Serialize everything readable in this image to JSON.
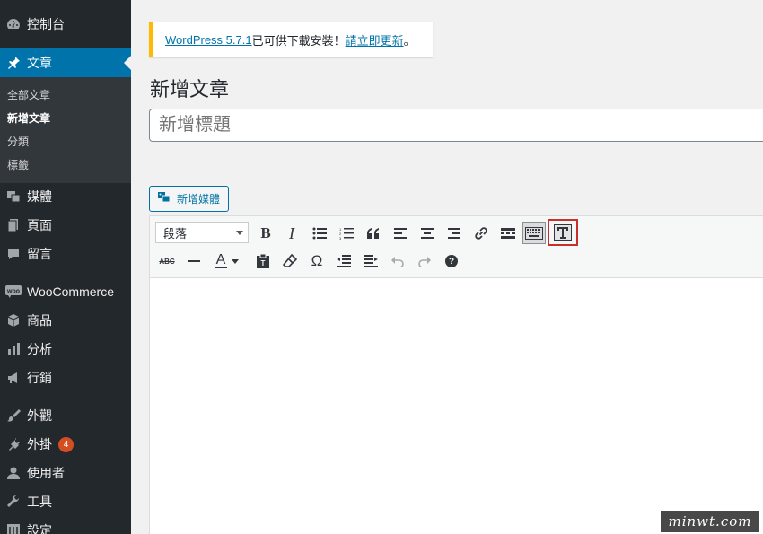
{
  "sidebar": {
    "dashboard": "控制台",
    "posts": "文章",
    "posts_sub": [
      "全部文章",
      "新增文章",
      "分類",
      "標籤"
    ],
    "media": "媒體",
    "pages": "頁面",
    "comments": "留言",
    "woocommerce": "WooCommerce",
    "products": "商品",
    "analytics": "分析",
    "marketing": "行銷",
    "appearance": "外觀",
    "plugins": "外掛",
    "plugins_badge": "4",
    "users": "使用者",
    "tools": "工具",
    "settings": "設定",
    "colors": {
      "bg": "#23282d",
      "active": "#0073aa",
      "submenu": "#32373c"
    }
  },
  "notice": {
    "link_version": "WordPress 5.7.1",
    "text": " 已可供下載安裝！",
    "link_update": "請立即更新",
    "end": "。"
  },
  "page_title": "新增文章",
  "title_placeholder": "新增標題",
  "add_media_label": "新增媒體",
  "toolbar": {
    "format_value": "段落",
    "row1_icons": [
      "bold-icon",
      "italic-icon",
      "bullet-list-icon",
      "numbered-list-icon",
      "blockquote-icon",
      "align-left-icon",
      "align-center-icon",
      "align-right-icon",
      "link-icon",
      "read-more-icon",
      "toolbar-toggle-icon",
      "distraction-free-icon"
    ],
    "row2_icons": [
      "strikethrough-icon",
      "horizontal-line-icon",
      "text-color-icon",
      "paste-text-icon",
      "clear-formatting-icon",
      "special-character-icon",
      "outdent-icon",
      "indent-icon",
      "undo-icon",
      "redo-icon",
      "help-icon"
    ],
    "bold": "B",
    "italic": "I",
    "strike": "ABC",
    "text_color": "A",
    "omega": "Ω",
    "help": "?",
    "highlight_color": "#c9302c"
  },
  "watermark": "minwt.com"
}
